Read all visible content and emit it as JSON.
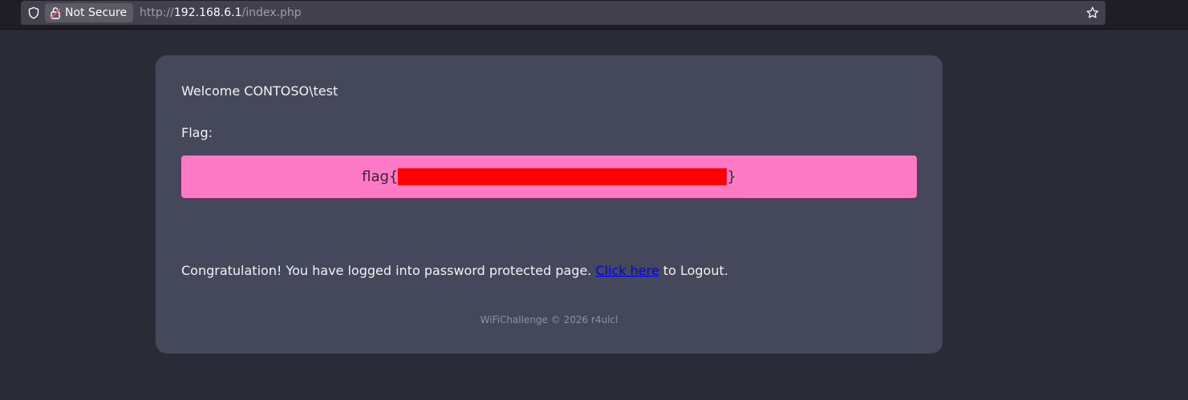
{
  "browser": {
    "security_label": "Not Secure",
    "url_prefix": "http://",
    "url_host": "192.168.6.1",
    "url_path": "/index.php"
  },
  "page": {
    "welcome": "Welcome CONTOSO\\test",
    "flag_label": "Flag:",
    "flag_prefix": "flag{",
    "flag_suffix": "}",
    "congrats_before": "Congratulation! You have logged into password protected page. ",
    "logout_link": "Click here",
    "congrats_after": " to Logout.",
    "footer": "WiFiChallenge © 2026 r4ulcl"
  },
  "colors": {
    "page_bg": "#2a2b37",
    "card_bg": "#45475b",
    "flag_bg": "#ff7ac6",
    "redaction": "#ff0000",
    "link": "#0000ee"
  }
}
